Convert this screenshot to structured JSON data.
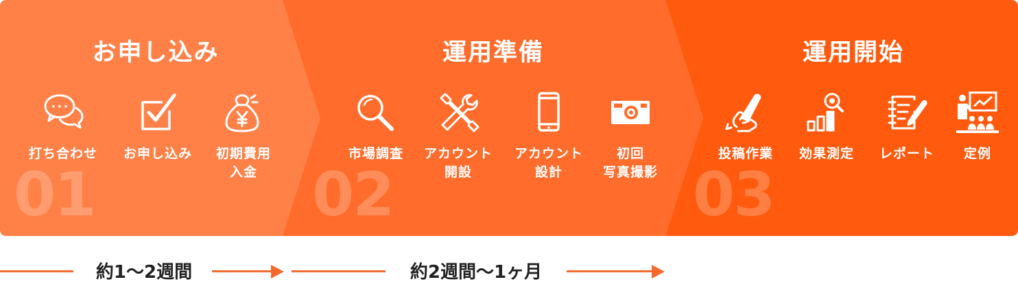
{
  "phases": [
    {
      "title": "お申し込み",
      "number": "01",
      "color": "#ff8148",
      "steps": [
        {
          "label": "打ち合わせ",
          "icon": "chat-bubbles-icon"
        },
        {
          "label": "お申し込み",
          "icon": "checkbox-icon"
        },
        {
          "label": "初期費用\n入金",
          "icon": "money-bag-yen-icon"
        }
      ]
    },
    {
      "title": "運用準備",
      "number": "02",
      "color": "#ff6c2b",
      "steps": [
        {
          "label": "市場調査",
          "icon": "magnifier-icon"
        },
        {
          "label": "アカウント\n開設",
          "icon": "tools-icon"
        },
        {
          "label": "アカウント\n設計",
          "icon": "smartphone-icon"
        },
        {
          "label": "初回\n写真撮影",
          "icon": "camera-icon"
        }
      ]
    },
    {
      "title": "運用開始",
      "number": "03",
      "color": "#ff5a0e",
      "steps": [
        {
          "label": "投稿作業",
          "icon": "hand-writing-icon"
        },
        {
          "label": "効果測定",
          "icon": "bar-chart-magnifier-icon"
        },
        {
          "label": "レポート",
          "icon": "notebook-pen-icon"
        },
        {
          "label": "定例",
          "icon": "presentation-meeting-icon"
        }
      ]
    }
  ],
  "durations": [
    {
      "label": "約1〜2週間"
    },
    {
      "label": "約2週間〜1ヶ月"
    }
  ],
  "arrow_color": "#f26a2e"
}
